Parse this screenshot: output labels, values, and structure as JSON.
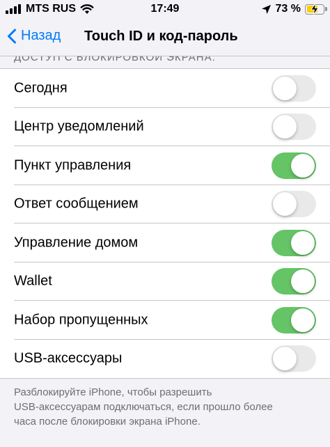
{
  "status_bar": {
    "carrier": "MTS RUS",
    "time": "17:49",
    "battery_percent": "73 %",
    "battery_level": 0.73,
    "battery_color": "#ffcc00",
    "icons": [
      "signal-icon",
      "wifi-icon",
      "location-icon",
      "battery-icon",
      "charging-icon"
    ]
  },
  "nav": {
    "back_label": "Назад",
    "title": "Touch ID и код-пароль",
    "accent_color": "#007aff"
  },
  "section": {
    "header": "ДОСТУП С БЛОКИРОВКОЙ ЭКРАНА:"
  },
  "toggles": [
    {
      "label": "Сегодня",
      "on": false
    },
    {
      "label": "Центр уведомлений",
      "on": false
    },
    {
      "label": "Пункт управления",
      "on": true
    },
    {
      "label": "Ответ сообщением",
      "on": false
    },
    {
      "label": "Управление домом",
      "on": true
    },
    {
      "label": "Wallet",
      "on": true
    },
    {
      "label": "Набор пропущенных",
      "on": true
    },
    {
      "label": "USB-аксессуары",
      "on": false
    }
  ],
  "footer": "Разблокируйте iPhone, чтобы разрешить\nUSB-аксессуарам подключаться, если прошло более\nчаса после блокировки экрана iPhone.",
  "colors": {
    "toggle_on": "#65c466",
    "toggle_off": "#e9e9ea"
  }
}
